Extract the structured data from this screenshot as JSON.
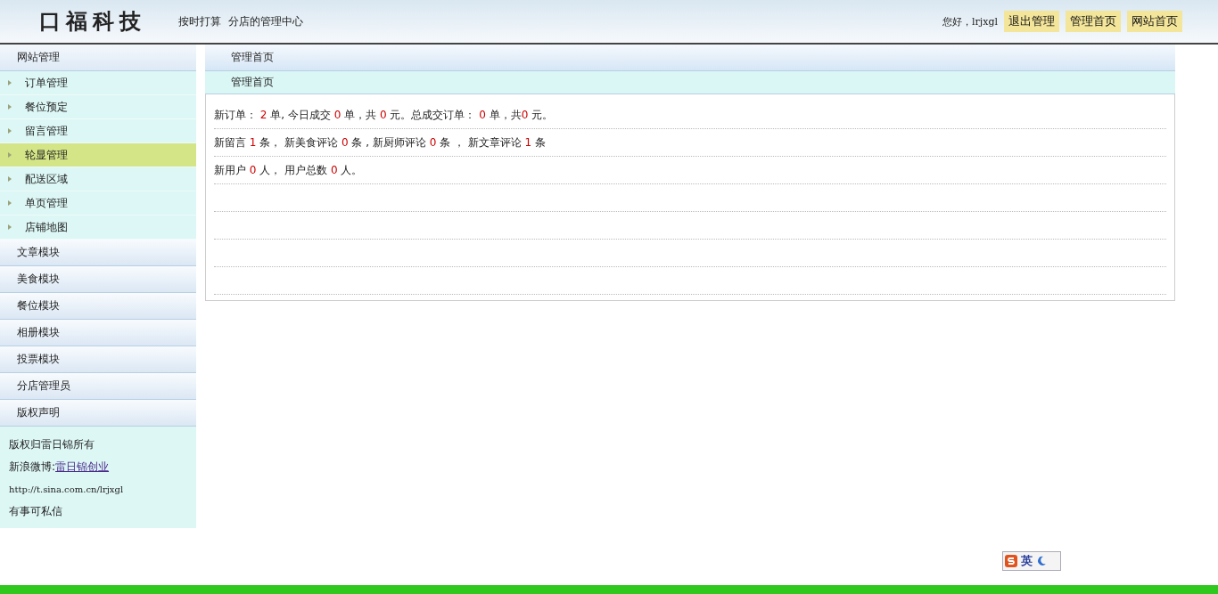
{
  "header": {
    "logo": "口福科技",
    "slogan": "按时打算  分店的管理中心",
    "greeting": "您好，lrjxgl",
    "links": [
      "退出管理",
      "管理首页",
      "网站首页"
    ]
  },
  "sidebar": {
    "sections": [
      {
        "title": "网站管理",
        "items": [
          {
            "label": "订单管理",
            "selected": false
          },
          {
            "label": "餐位预定",
            "selected": false
          },
          {
            "label": "留言管理",
            "selected": false
          },
          {
            "label": "轮显管理",
            "selected": true
          },
          {
            "label": "配送区域",
            "selected": false
          },
          {
            "label": "单页管理",
            "selected": false
          },
          {
            "label": "店铺地图",
            "selected": false
          }
        ]
      },
      {
        "title": "文章模块"
      },
      {
        "title": "美食模块"
      },
      {
        "title": "餐位模块"
      },
      {
        "title": "相册模块"
      },
      {
        "title": "投票模块"
      },
      {
        "title": "分店管理员"
      },
      {
        "title": "版权声明"
      }
    ],
    "footer": {
      "copyright": "版权归雷日锦所有",
      "weibo_label": "新浪微博:",
      "weibo_link": "雷日锦创业",
      "url": "http://t.sina.com.cn/lrjxgl",
      "note": "有事可私信"
    }
  },
  "main": {
    "title": "管理首页",
    "subtitle": "管理首页",
    "stats": [
      [
        {
          "text": "新订单： "
        },
        {
          "text": "2",
          "highlight": true
        },
        {
          "text": " 单, 今日成交 "
        },
        {
          "text": "0",
          "highlight": true
        },
        {
          "text": " 单，共 "
        },
        {
          "text": "0",
          "highlight": true
        },
        {
          "text": " 元。总成交订单： "
        },
        {
          "text": "0",
          "highlight": true
        },
        {
          "text": " 单，共"
        },
        {
          "text": "0",
          "highlight": true
        },
        {
          "text": " 元。"
        }
      ],
      [
        {
          "text": "新留言 "
        },
        {
          "text": "1",
          "highlight": true
        },
        {
          "text": " 条， 新美食评论 "
        },
        {
          "text": "0",
          "highlight": true
        },
        {
          "text": " 条 , 新厨师评论 "
        },
        {
          "text": "0",
          "highlight": true
        },
        {
          "text": " 条 ， 新文章评论 "
        },
        {
          "text": "1",
          "highlight": true
        },
        {
          "text": " 条"
        }
      ],
      [
        {
          "text": "新用户 "
        },
        {
          "text": "0",
          "highlight": true
        },
        {
          "text": " 人， 用户总数 "
        },
        {
          "text": "0",
          "highlight": true
        },
        {
          "text": " 人。"
        }
      ]
    ]
  },
  "ime": {
    "mode": "英"
  }
}
